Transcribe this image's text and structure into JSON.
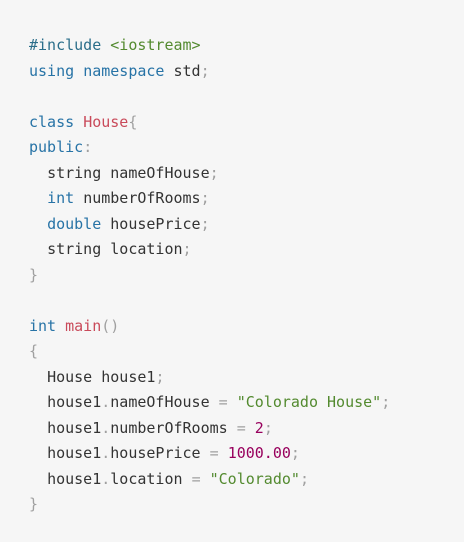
{
  "code": {
    "include_directive": "#include",
    "include_header": "<iostream>",
    "using": "using",
    "namespace": "namespace",
    "std": "std",
    "semicolon": ";",
    "class_kw": "class",
    "class_name": "House",
    "open_brace": "{",
    "close_brace": "}",
    "public_kw": "public",
    "colon": ":",
    "members": [
      {
        "type": "string",
        "name": "nameOfHouse"
      },
      {
        "type": "int",
        "name": "numberOfRooms"
      },
      {
        "type": "double",
        "name": "housePrice"
      },
      {
        "type": "string",
        "name": "location"
      }
    ],
    "int_kw": "int",
    "main_fn": "main",
    "parens": "()",
    "decl_type": "House",
    "decl_var": "house1",
    "assignments": [
      {
        "obj": "house1",
        "dot": ".",
        "field": "nameOfHouse",
        "op": "=",
        "value": "\"Colorado House\""
      },
      {
        "obj": "house1",
        "dot": ".",
        "field": "numberOfRooms",
        "op": "=",
        "value": "2"
      },
      {
        "obj": "house1",
        "dot": ".",
        "field": "housePrice",
        "op": "=",
        "value": "1000.00"
      },
      {
        "obj": "house1",
        "dot": ".",
        "field": "location",
        "op": "=",
        "value": "\"Colorado\""
      }
    ]
  },
  "colors": {
    "background": "#f6f6f6",
    "preprocessor": "#2b6e8a",
    "string": "#538a2f",
    "keyword": "#2773a6",
    "class_name": "#c94a5a",
    "punctuation": "#a0a0a0",
    "number": "#98005d",
    "text": "#333333"
  }
}
